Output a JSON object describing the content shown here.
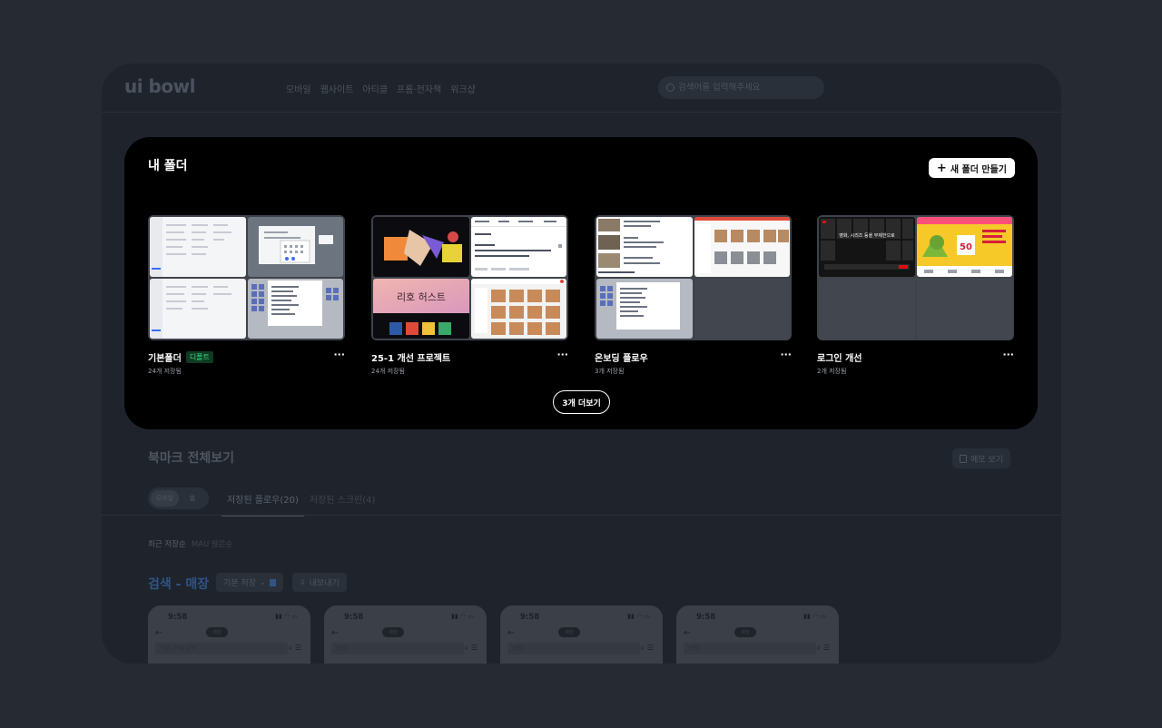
{
  "header": {
    "logo": "ui bowl",
    "nav": [
      "모바일",
      "웹사이트",
      "아티클",
      "프롬·전자책",
      "워크샵"
    ],
    "search_placeholder": "검색어를 입력해주세요"
  },
  "modal": {
    "title": "내 폴더",
    "new_folder_label": "새 폴더 만들기",
    "folders": [
      {
        "name": "기본폴더",
        "badge": "디폴트",
        "count": "24개 저장됨"
      },
      {
        "name": "25-1 개선 프로젝트",
        "badge": "",
        "count": "24개 저장됨"
      },
      {
        "name": "온보딩 플로우",
        "badge": "",
        "count": "3개 저장됨"
      },
      {
        "name": "로그인 개선",
        "badge": "",
        "count": "2개 저장됨"
      }
    ],
    "more_label": "3개 더보기",
    "thumb_texts": {
      "event_title": "리호 허스트",
      "promo_number": "50",
      "login_headline": "영화, 시리즈 등을 무제한으로"
    }
  },
  "page": {
    "bookmark_title": "북마크 전체보기",
    "memo_label": "메모 보기",
    "toggle": [
      "모바일",
      "웹"
    ],
    "tabs": [
      "저장된 플로우(20)",
      "저장된 스크린(4)"
    ],
    "sort": [
      "최근 저장순",
      "MAU 많은순"
    ],
    "flow_title": "검색 - 매장",
    "basic_save_label": "기본 저장",
    "export_label": "내보내기",
    "phones": [
      {
        "time": "9:58",
        "pill": "매장",
        "search": "식당, 카페 검색"
      },
      {
        "time": "9:58",
        "pill": "매장",
        "search": "산림"
      },
      {
        "time": "9:58",
        "pill": "매장",
        "search": "산림"
      },
      {
        "time": "9:58",
        "pill": "매장",
        "search": "산림"
      }
    ]
  }
}
